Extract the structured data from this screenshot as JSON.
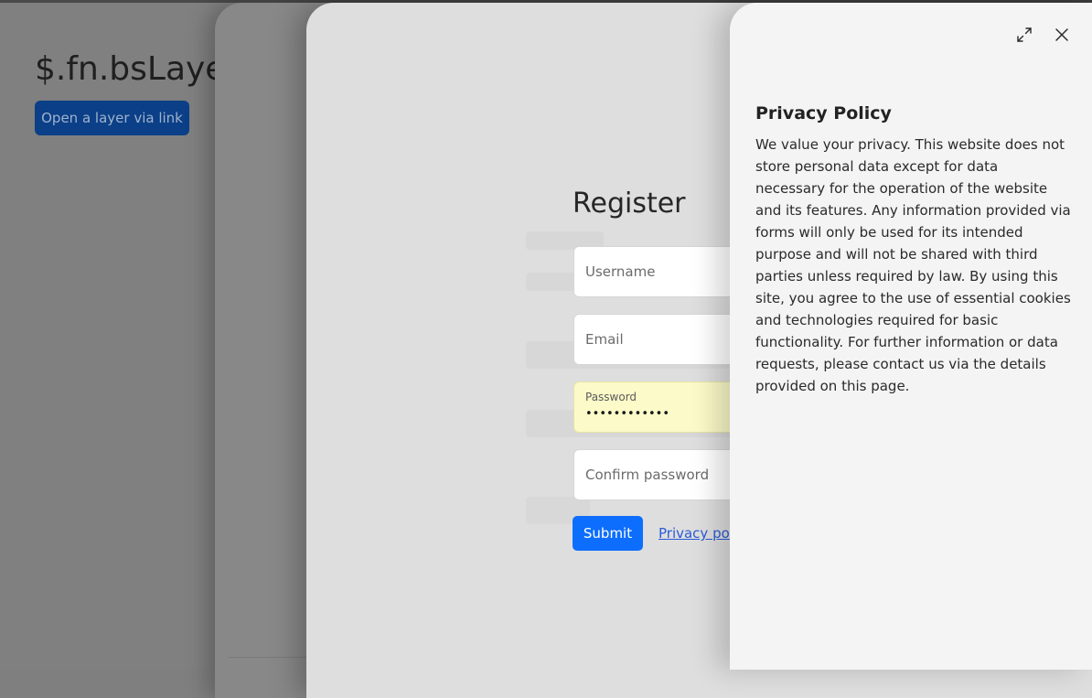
{
  "base": {
    "title": "$.fn.bsLayer",
    "open_button_label": "Open a layer via link"
  },
  "register": {
    "title": "Register",
    "username_placeholder": "Username",
    "email_placeholder": "Email",
    "password_label": "Password",
    "password_value": "••••••••••••",
    "confirm_placeholder": "Confirm password",
    "submit_label": "Submit",
    "privacy_link_label": "Privacy policy"
  },
  "privacy": {
    "title": "Privacy Policy",
    "body": "We value your privacy. This website does not store personal data except for data necessary for the operation of the website and its features. Any information provided via forms will only be used for its intended purpose and will not be shared with third parties unless required by law. By using this site, you agree to the use of essential cookies and technologies required for basic functionality. For further information or data requests, please contact us via the details provided on this page.",
    "expand_icon": "expand-icon",
    "close_icon": "close-icon"
  },
  "colors": {
    "primary": "#0d6efd",
    "overlay_gray": "#808080",
    "autofill_yellow": "#fbfac8"
  }
}
